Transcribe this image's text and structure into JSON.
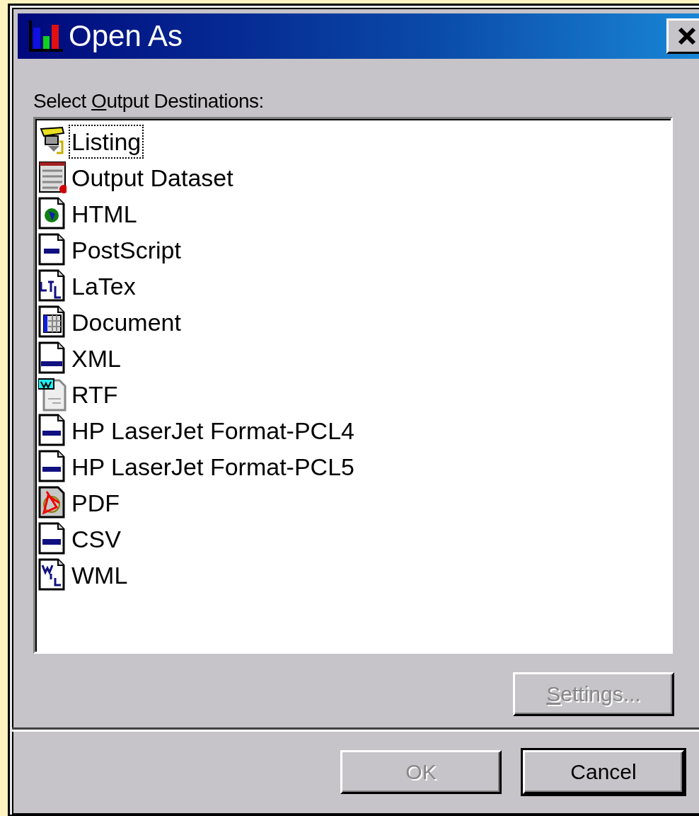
{
  "window": {
    "title": "Open As"
  },
  "destinations": {
    "label": {
      "before": "Select ",
      "key": "O",
      "after": "utput Destinations:"
    },
    "items": [
      {
        "label": "Listing",
        "kind": "listing",
        "selected": true
      },
      {
        "label": "Output Dataset",
        "kind": "dataset",
        "selected": false
      },
      {
        "label": "HTML",
        "kind": "html",
        "selected": false
      },
      {
        "label": "PostScript",
        "kind": "postscript",
        "selected": false
      },
      {
        "label": "LaTex",
        "kind": "latex",
        "selected": false
      },
      {
        "label": "Document",
        "kind": "document",
        "selected": false
      },
      {
        "label": "XML",
        "kind": "xml",
        "selected": false
      },
      {
        "label": "RTF",
        "kind": "rtf",
        "selected": false
      },
      {
        "label": "HP LaserJet Format-PCL4",
        "kind": "pcl",
        "selected": false
      },
      {
        "label": "HP LaserJet Format-PCL5",
        "kind": "pcl",
        "selected": false
      },
      {
        "label": "PDF",
        "kind": "pdf",
        "selected": false
      },
      {
        "label": "CSV",
        "kind": "csv",
        "selected": false
      },
      {
        "label": "WML",
        "kind": "wml",
        "selected": false
      }
    ]
  },
  "settings_button": {
    "key": "S",
    "after": "ettings...",
    "disabled": true
  },
  "buttons": [
    {
      "label": "OK",
      "disabled": true,
      "default": false
    },
    {
      "label": "Cancel",
      "disabled": false,
      "default": true
    }
  ]
}
